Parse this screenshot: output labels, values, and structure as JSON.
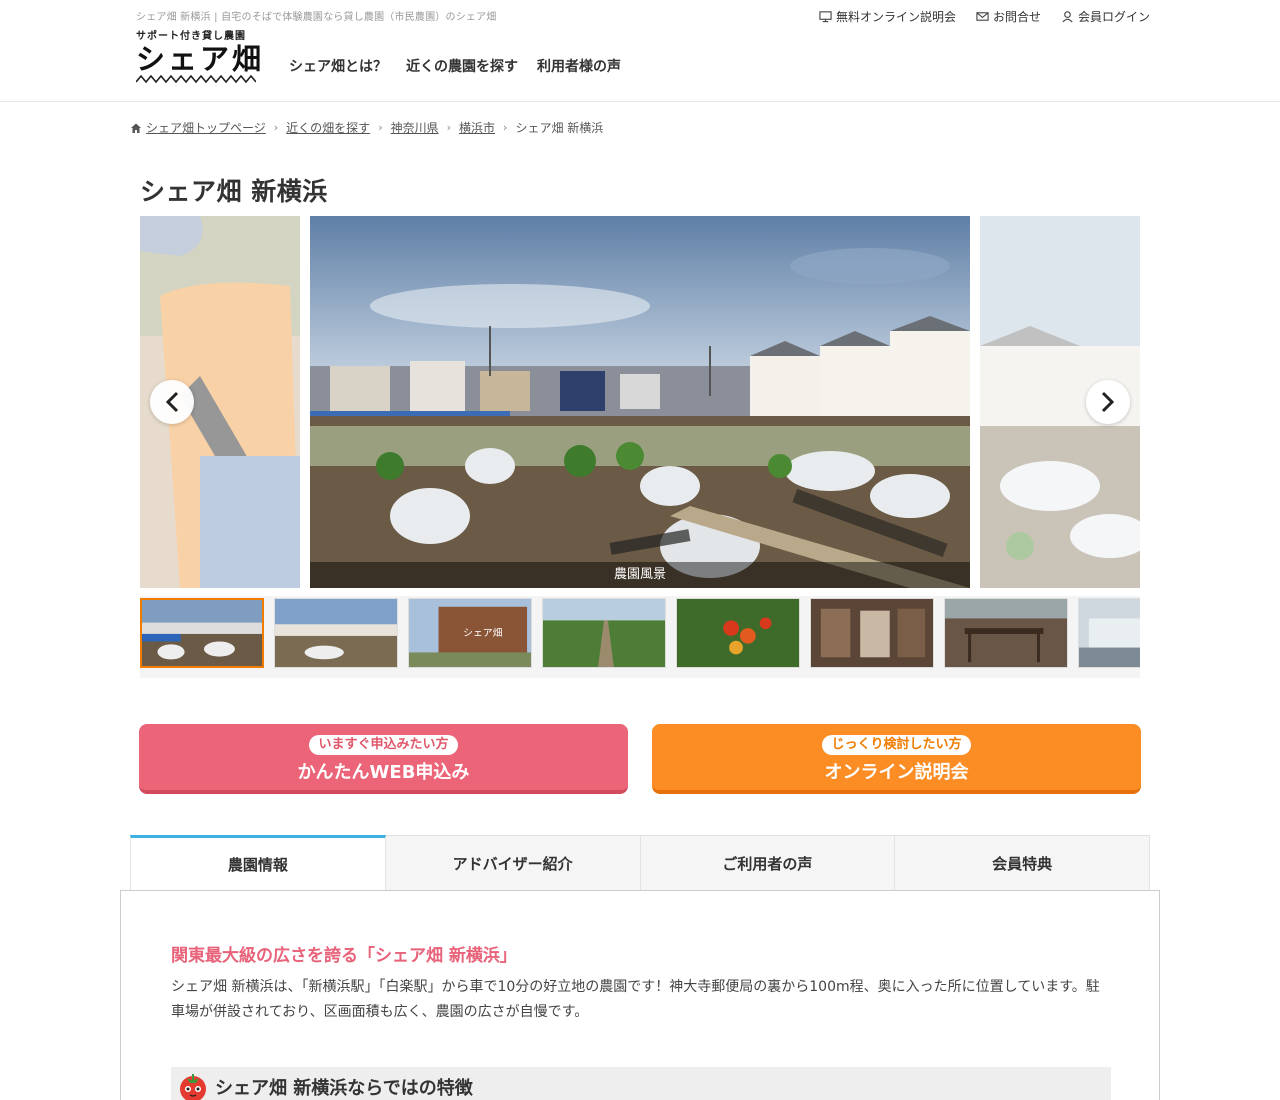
{
  "header": {
    "tagline": "シェア畑 新横浜 | 自宅のそばで体験農園なら貸し農園（市民農園）のシェア畑",
    "logo_sub": "サポート付き貸し農園",
    "logo_main": "シェア畑",
    "nav": [
      "シェア畑とは？",
      "近くの農園を探す",
      "利用者様の声"
    ],
    "util": [
      {
        "label": "無料オンライン説明会",
        "icon": "monitor-icon"
      },
      {
        "label": "お問合せ",
        "icon": "mail-icon"
      },
      {
        "label": "会員ログイン",
        "icon": "user-icon"
      }
    ]
  },
  "breadcrumb": {
    "items": [
      "シェア畑トップページ",
      "近くの畑を探す",
      "神奈川県",
      "横浜市"
    ],
    "current": "シェア畑 新横浜"
  },
  "page_title": "シェア畑 新横浜",
  "slider": {
    "caption": "農園風景",
    "thumb_count": 8,
    "active_thumb": 1
  },
  "cta": {
    "apply": {
      "pill": "いますぐ申込みたい方",
      "label": "かんたんWEB申込み"
    },
    "online": {
      "pill": "じっくり検討したい方",
      "label": "オンライン説明会"
    }
  },
  "tabs": [
    "農園情報",
    "アドバイザー紹介",
    "ご利用者の声",
    "会員特典"
  ],
  "active_tab": 0,
  "content": {
    "heading": "関東最大級の広さを誇る「シェア畑 新横浜」",
    "body": "シェア畑 新横浜は、「新横浜駅」「白楽駅」から車で10分の好立地の農園です！神大寺郵便局の裏から100m程、奥に入った所に位置しています。駐車場が併設されており、区画面積も広く、農園の広さが自慢です。",
    "feature_title": "シェア畑 新横浜ならではの特徴"
  },
  "colors": {
    "apply": "#ec6478",
    "online": "#fb8d24",
    "heading": "#e8627a",
    "tab_accent": "#3db1e0",
    "thumb_active": "#f07c00"
  }
}
